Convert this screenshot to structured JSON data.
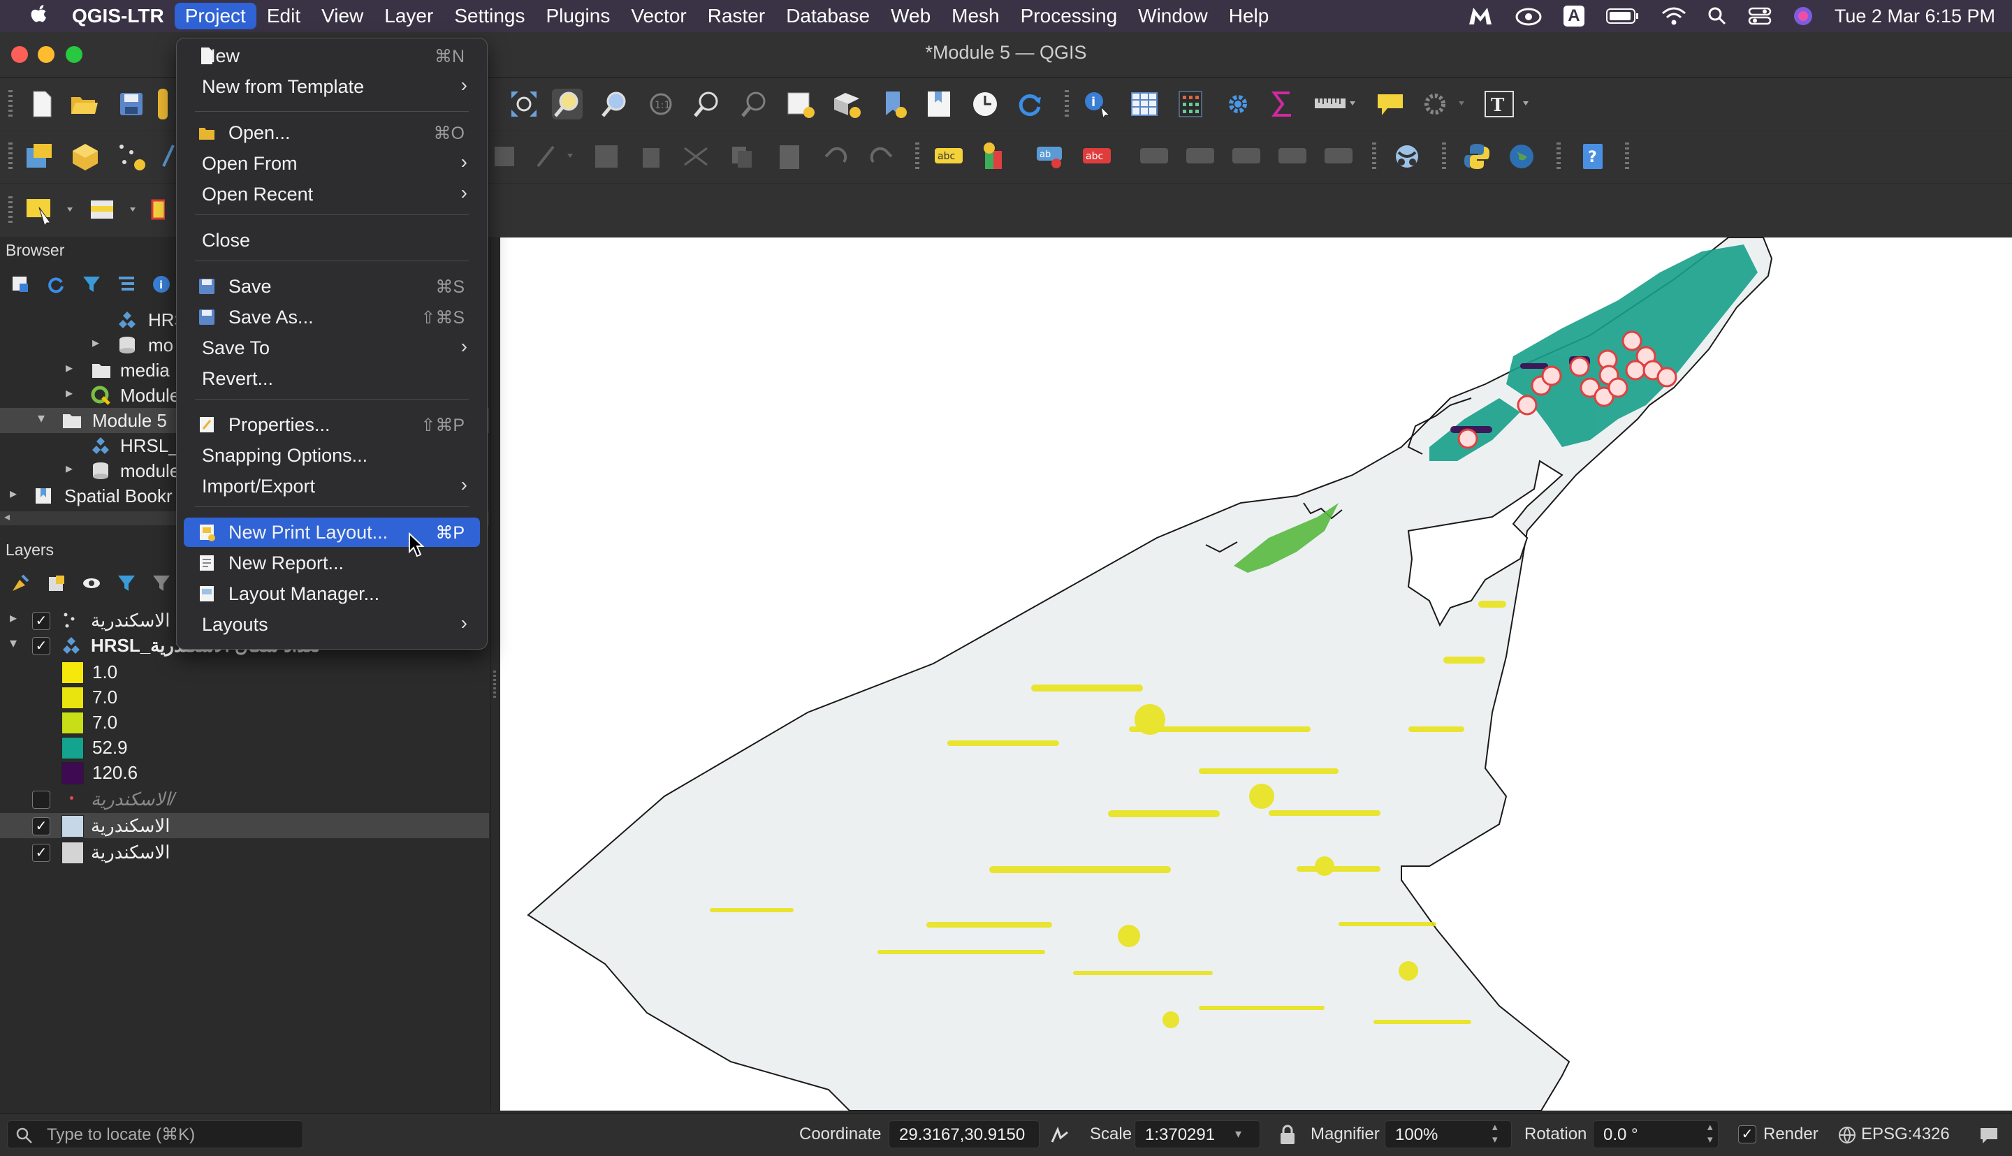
{
  "menubar": {
    "app": "QGIS-LTR",
    "items": [
      "Project",
      "Edit",
      "View",
      "Layer",
      "Settings",
      "Plugins",
      "Vector",
      "Raster",
      "Database",
      "Web",
      "Mesh",
      "Processing",
      "Window",
      "Help"
    ],
    "active": "Project",
    "input_source": "A",
    "clock": "Tue 2 Mar  6:15 PM"
  },
  "window": {
    "title": "*Module 5 — QGIS"
  },
  "project_menu": {
    "new": {
      "label": "New",
      "shortcut": "⌘N"
    },
    "new_from_template": {
      "label": "New from Template"
    },
    "open": {
      "label": "Open...",
      "shortcut": "⌘O"
    },
    "open_from": {
      "label": "Open From"
    },
    "open_recent": {
      "label": "Open Recent"
    },
    "close": {
      "label": "Close"
    },
    "save": {
      "label": "Save",
      "shortcut": "⌘S"
    },
    "save_as": {
      "label": "Save As...",
      "shortcut": "⇧⌘S"
    },
    "save_to": {
      "label": "Save To"
    },
    "revert": {
      "label": "Revert..."
    },
    "properties": {
      "label": "Properties...",
      "shortcut": "⇧⌘P"
    },
    "snapping": {
      "label": "Snapping Options..."
    },
    "import_export": {
      "label": "Import/Export"
    },
    "new_print_layout": {
      "label": "New Print Layout...",
      "shortcut": "⌘P"
    },
    "new_report": {
      "label": "New Report..."
    },
    "layout_manager": {
      "label": "Layout Manager..."
    },
    "layouts": {
      "label": "Layouts"
    }
  },
  "browser": {
    "title": "Browser",
    "items": [
      "HRS",
      "mo",
      "media",
      "Module",
      "Module 5",
      "HRSL_",
      "module",
      "Spatial Bookr"
    ]
  },
  "layers": {
    "title": "Layers",
    "rows": [
      {
        "name": "الاسكندرية ·",
        "checked": true
      },
      {
        "name": "HRSL_تعداد سكان الاسكندرية",
        "checked": true
      }
    ],
    "legend": [
      {
        "value": "1.0",
        "color": "#f7e80b"
      },
      {
        "value": "7.0",
        "color": "#e9e40e"
      },
      {
        "value": "7.0",
        "color": "#c8de17"
      },
      {
        "value": "52.9",
        "color": "#14a38d"
      },
      {
        "value": "120.6",
        "color": "#3e0a52"
      }
    ],
    "extra_rows": [
      {
        "name": "الاسكندرية/",
        "checked": false
      },
      {
        "name": "الاسكندرية",
        "checked": true
      },
      {
        "name": "الاسكندرية",
        "checked": true
      }
    ]
  },
  "statusbar": {
    "locate_placeholder": "Type to locate (⌘K)",
    "coordinate_label": "Coordinate",
    "coordinate_value": "29.3167,30.9150",
    "scale_label": "Scale",
    "scale_value": "1:370291",
    "magnifier_label": "Magnifier",
    "magnifier_value": "100%",
    "rotation_label": "Rotation",
    "rotation_value": "0.0 °",
    "render_label": "Render",
    "crs": "EPSG:4326"
  }
}
